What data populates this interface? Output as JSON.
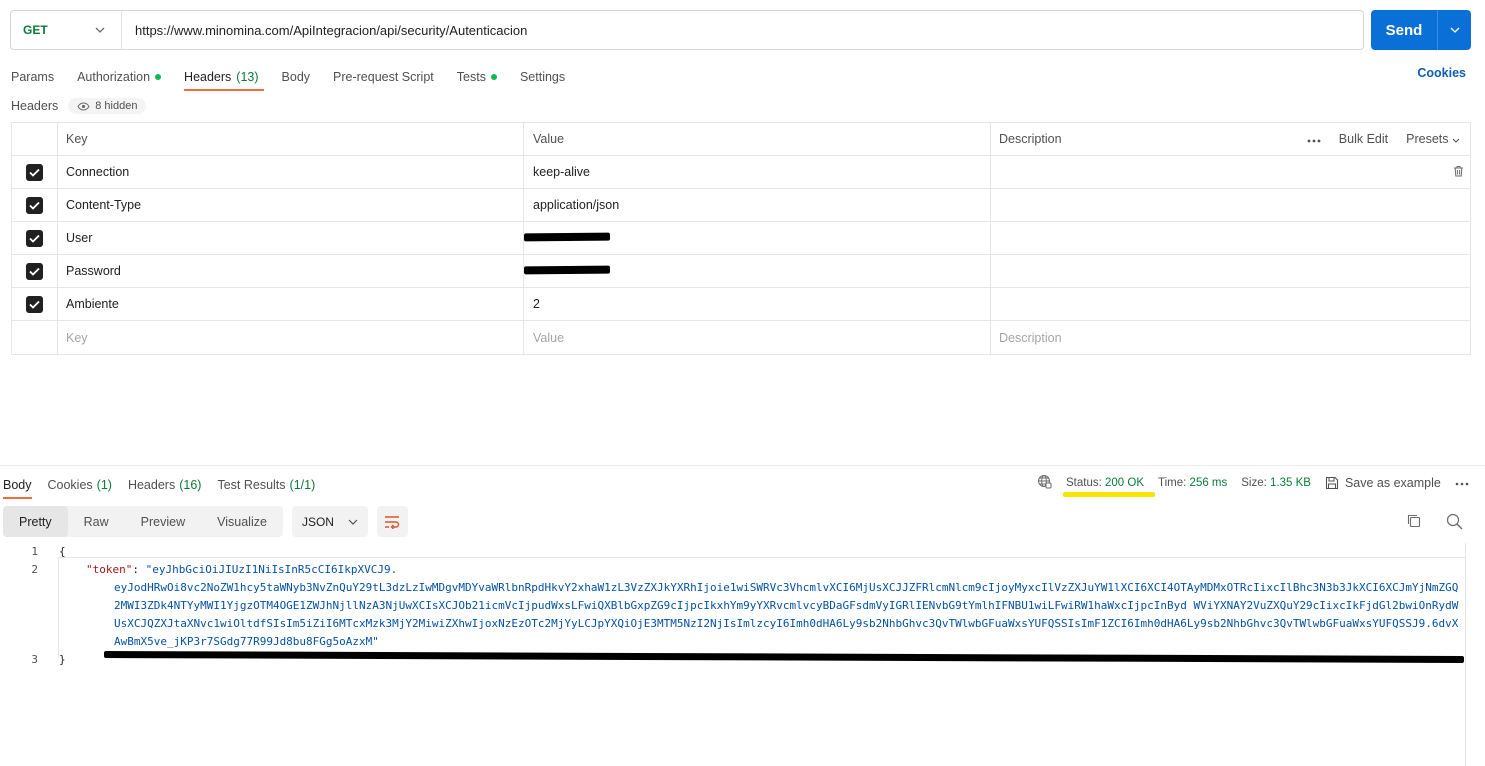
{
  "request": {
    "method": "GET",
    "url": "https://www.minomina.com/ApiIntegracion/api/security/Autenticacion",
    "send_label": "Send"
  },
  "request_tabs": [
    {
      "label": "Params"
    },
    {
      "label": "Authorization",
      "dot": true
    },
    {
      "label": "Headers",
      "count": "(13)",
      "active": true
    },
    {
      "label": "Body"
    },
    {
      "label": "Pre-request Script"
    },
    {
      "label": "Tests",
      "dot": true
    },
    {
      "label": "Settings"
    }
  ],
  "cookies_link": "Cookies",
  "headers_section": {
    "label": "Headers",
    "hidden_label": "8 hidden"
  },
  "headers_table": {
    "columns": {
      "key": "Key",
      "value": "Value",
      "description": "Description"
    },
    "bulk_edit": "Bulk Edit",
    "presets": "Presets",
    "rows": [
      {
        "key": "Connection",
        "value": "keep-alive",
        "checked": true
      },
      {
        "key": "Content-Type",
        "value": "application/json",
        "checked": true
      },
      {
        "key": "User",
        "value": "",
        "checked": true,
        "redacted": true
      },
      {
        "key": "Password",
        "value": "",
        "checked": true,
        "redacted": true
      },
      {
        "key": "Ambiente",
        "value": "2",
        "checked": true
      }
    ],
    "placeholders": {
      "key": "Key",
      "value": "Value",
      "description": "Description"
    }
  },
  "response_tabs": [
    {
      "label": "Body",
      "active": true
    },
    {
      "label": "Cookies",
      "count": "(1)"
    },
    {
      "label": "Headers",
      "count": "(16)"
    },
    {
      "label": "Test Results",
      "count": "(1/1)"
    }
  ],
  "status": {
    "status_label": "Status:",
    "status_value": "200 OK",
    "time_label": "Time:",
    "time_value": "256 ms",
    "size_label": "Size:",
    "size_value": "1.35 KB",
    "save_example": "Save as example"
  },
  "format_bar": {
    "modes": [
      "Pretty",
      "Raw",
      "Preview",
      "Visualize"
    ],
    "active_mode": "Pretty",
    "language": "JSON"
  },
  "response_body": {
    "line_numbers": [
      "1",
      "2",
      "3"
    ],
    "open_brace": "{",
    "close_brace": "}",
    "token_key": "\"token\"",
    "token_value_line1": "\"eyJhbGciOiJIUzI1NiIsInR5cCI6IkpXVCJ9.",
    "token_value_rest": "eyJodHRwOi8vc2NoZW1hcy5taWNyb3NvZnQuY29tL3dzLzIwMDgvMDYvaWRlbnRpdHkvY2xhaW1zL3VzZXJkYXRhIjoie1wiSWRVc3VhcmlvXCI6MjUsXCJJZFRlcmNlcm9cIjoyMyxcIlVzZXJuYW1lXCI6XCI4OTAyMDMxOTRcIixcIlBhc3N3b3JkXCI6XCJmYjNmZGQ2MWI3ZDk4NTYyMWI1YjgzOTM4OGE1ZWJhNjllNzA3NjUwXCIsXCJOb21icmVcIjpudWxsLFwiQXBlbGxpZG9cIjpcIkxhYm9yYXRvcmlvcyBDaGFsdmVyIGRlIENvbG9tYmlhIFNBU1wiLFwiRW1haWxcIjpcInByd WViYXNAY2VuZXQuY29cIixcIkFjdGl2bwiOnRydWUsXCJQZXJtaXNvc1wiOltdfSIsIm5iZiI6MTcxMzk3MjY2MiwiZXhwIjoxNzEzOTc2MjYyLCJpYXQiOjE3MTM5NzI2NjIsImlzcyI6Imh0dHA6Ly9sb2NhbGhvc3QvTWlwbGFuaWxsYUFQSSIsImF1ZCI6Imh0dHA6Ly9sb2NhbGhvc3QvTWlwbGFuaWxsYUFQSSJ9.6dvXAwBmX5ve_jKP3r7SGdg77R99Jd8bu8FGg5oAzxM\""
  },
  "icons": {
    "method_chevron": "chevron-down-icon",
    "send_caret": "chevron-down-icon",
    "hidden_eye": "eye-icon",
    "more": "more-horizontal-icon",
    "trash": "trash-icon",
    "globe": "globe-icon",
    "save": "save-icon",
    "wrap": "wrap-lines-icon",
    "copy": "copy-icon",
    "search": "search-icon"
  },
  "colors": {
    "send_button": "#0a6fd6",
    "method_get": "#0a7a3a",
    "status_ok": "#0a7a3a",
    "active_tab_underline": "#f26b3a",
    "highlight": "#f7e500"
  }
}
